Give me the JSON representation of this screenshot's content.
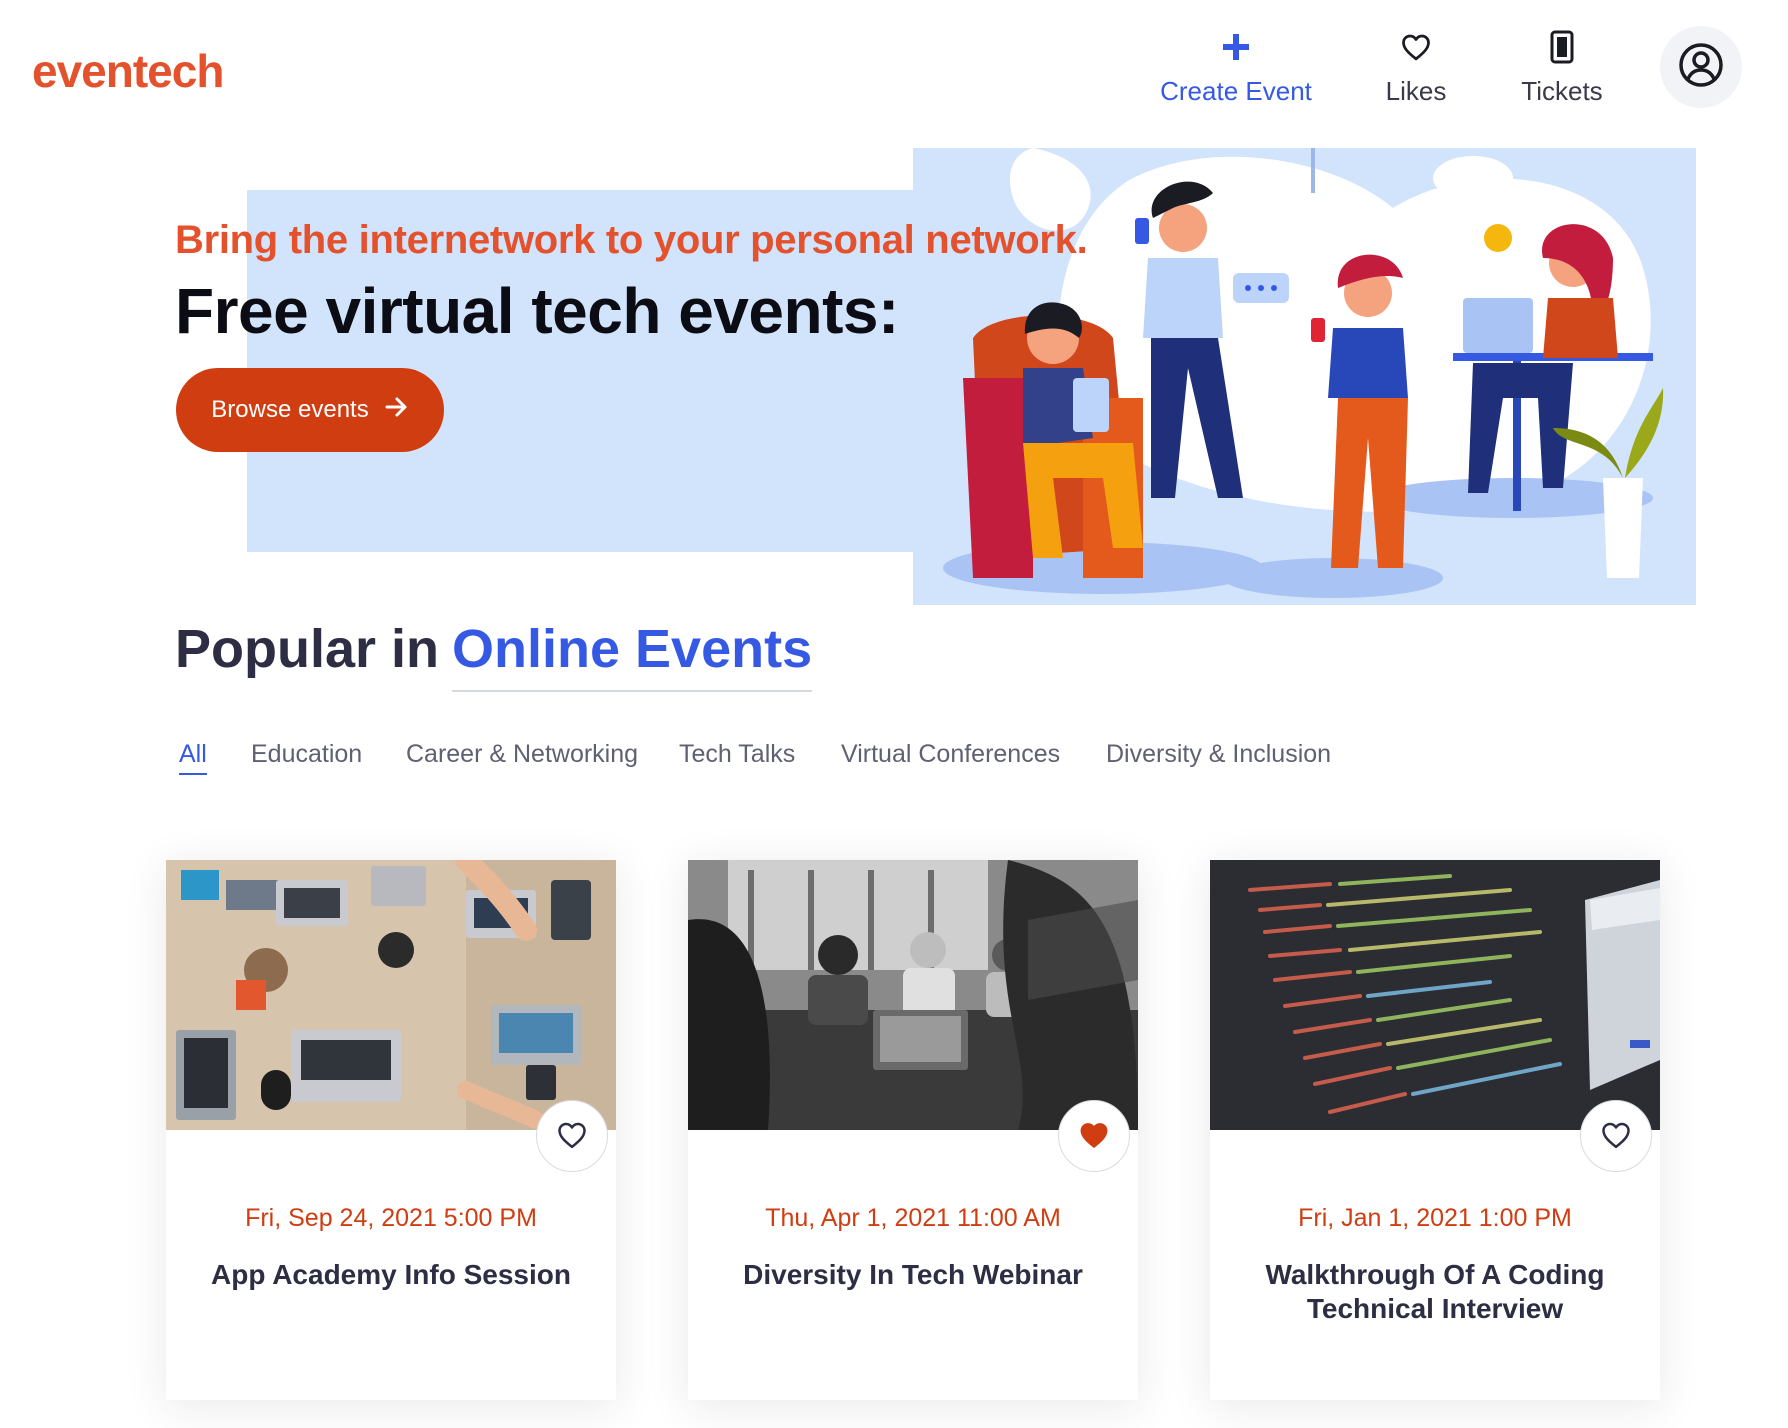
{
  "header": {
    "logo": "eventech",
    "nav": {
      "create_event": "Create Event",
      "likes": "Likes",
      "tickets": "Tickets"
    },
    "icons": [
      "plus-icon",
      "heart-outline-icon",
      "ticket-icon",
      "user-circle-icon"
    ]
  },
  "hero": {
    "tagline": "Bring the internetwork to your personal network.",
    "title": "Free virtual tech events:",
    "cta_label": "Browse events"
  },
  "popular": {
    "prefix": "Popular in",
    "highlight": "Online Events"
  },
  "filters": [
    {
      "label": "All",
      "active": true
    },
    {
      "label": "Education",
      "active": false
    },
    {
      "label": "Career & Networking",
      "active": false
    },
    {
      "label": "Tech Talks",
      "active": false
    },
    {
      "label": "Virtual Conferences",
      "active": false
    },
    {
      "label": "Diversity & Inclusion",
      "active": false
    }
  ],
  "events": [
    {
      "date": "Fri, Sep 24, 2021 5:00 PM",
      "title": "App Academy Info Session",
      "liked": false
    },
    {
      "date": "Thu, Apr 1, 2021 11:00 AM",
      "title": "Diversity In Tech Webinar",
      "liked": true
    },
    {
      "date": "Fri, Jan 1, 2021 1:00 PM",
      "title": "Walkthrough Of A Coding Technical Interview",
      "liked": false
    }
  ],
  "colors": {
    "brand": "#e4512d",
    "accent_blue": "#3659e3",
    "cta": "#cf3d11",
    "hero_bg": "#d2e3fc",
    "liked_heart": "#cf3d11"
  }
}
